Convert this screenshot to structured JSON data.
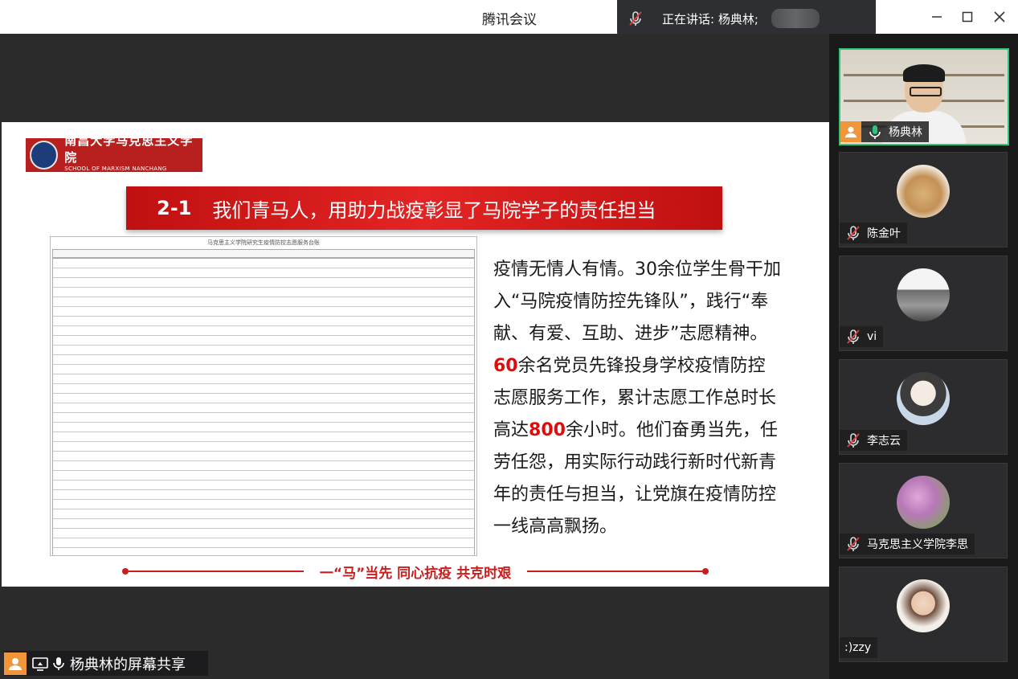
{
  "window": {
    "title": "腾讯会议"
  },
  "speaking": {
    "label": "正在讲话: 杨典林;"
  },
  "slide": {
    "logo_cn": "南昌大学马克思主义学院",
    "logo_en": "SCHOOL OF MARXISM NANCHANG UNIVERSITY",
    "section_number": "2-1",
    "heading": "我们青马人，用助力战疫彰显了马院学子的责任担当",
    "table_title": "马克思主义学院研究生疫情防控志愿服务台账",
    "paragraph": {
      "part1": "疫情无情人有情。30余位学生骨干加入“马院疫情防控先锋队”，践行“奉献、有爱、互助、进步”志愿精神。",
      "num1": "60",
      "part2": "余名党员先锋投身学校疫情防控志愿服务工作，累计志愿工作总时长高达",
      "num2": "800",
      "part3": "余小时。他们奋勇当先，任劳任怨，用实际行动践行新时代新青年的责任与担当，让党旗在疫情防控一线高高飘扬。"
    },
    "slogan": "一“马”当先  同心抗疫  共克时艰"
  },
  "share_label": "杨典林的屏幕共享",
  "participants": [
    {
      "name": "杨典林"
    },
    {
      "name": "陈金叶"
    },
    {
      "name": "vi"
    },
    {
      "name": "李志云"
    },
    {
      "name": "马克思主义学院李思"
    },
    {
      "name": ":)zzy"
    }
  ],
  "colors": {
    "accent_red": "#e00c0c",
    "active_border": "#2fc57a",
    "avatar_orange": "#f0953a"
  }
}
